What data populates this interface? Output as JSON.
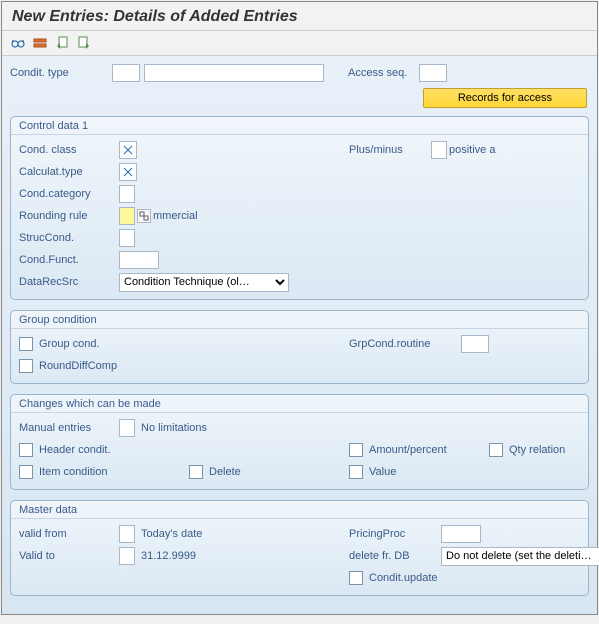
{
  "title": "New Entries: Details of Added Entries",
  "top": {
    "condit_type_label": "Condit. type",
    "access_seq_label": "Access seq.",
    "records_button": "Records for access"
  },
  "control_data_1": {
    "title": "Control data 1",
    "cond_class_label": "Cond. class",
    "calculat_type_label": "Calculat.type",
    "cond_category_label": "Cond.category",
    "rounding_rule_label": "Rounding rule",
    "rounding_rule_text": "mmercial",
    "struccond_label": "StrucCond.",
    "cond_funct_label": "Cond.Funct.",
    "datarecsrc_label": "DataRecSrc",
    "datarecsrc_value": "Condition Technique (ol…",
    "plus_minus_label": "Plus/minus",
    "plus_minus_text": "positive a"
  },
  "group_condition": {
    "title": "Group condition",
    "group_cond_label": "Group cond.",
    "round_diff_comp_label": "RoundDiffComp",
    "grpcond_routine_label": "GrpCond.routine"
  },
  "changes": {
    "title": "Changes which can be made",
    "manual_entries_label": "Manual entries",
    "no_limitations_text": "No limitations",
    "header_condit_label": "Header condit.",
    "item_condition_label": "Item condition",
    "delete_label": "Delete",
    "amount_percent_label": "Amount/percent",
    "value_label": "Value",
    "qty_relation_label": "Qty relation"
  },
  "master_data": {
    "title": "Master data",
    "valid_from_label": "valid from",
    "valid_from_text": "Today's date",
    "valid_to_label": "Valid to",
    "valid_to_text": "31.12.9999",
    "pricing_proc_label": "PricingProc",
    "delete_fr_db_label": "delete fr. DB",
    "delete_fr_db_value": "Do not delete (set the deleti…",
    "condit_update_label": "Condit.update"
  }
}
